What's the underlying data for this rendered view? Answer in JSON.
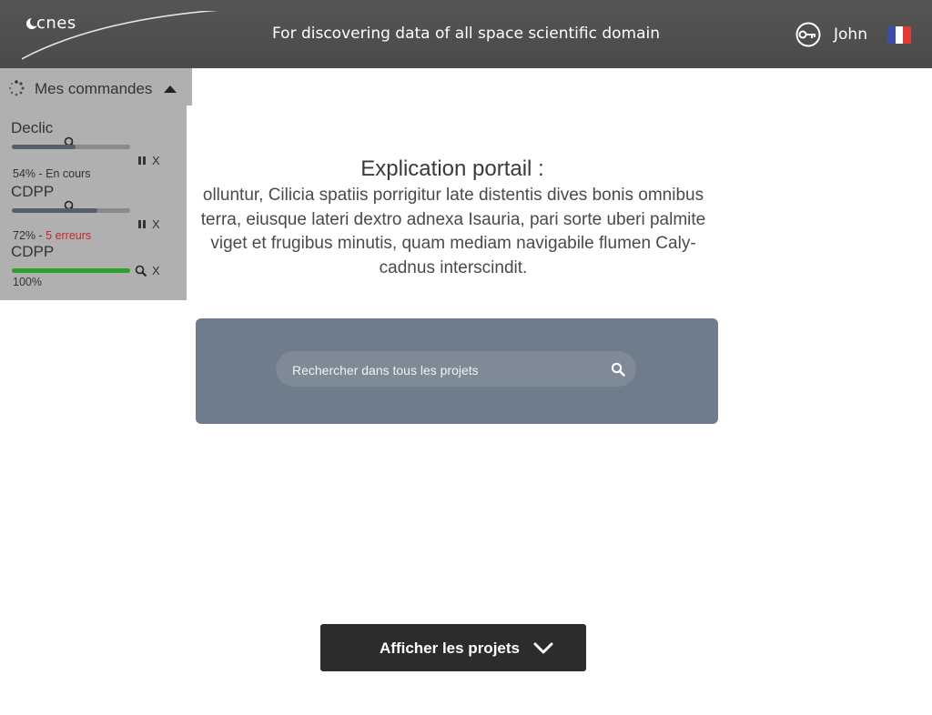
{
  "header": {
    "logo_text": "cnes",
    "tagline": "For discovering data of all space scientific domain",
    "username": "John",
    "flag_colors": [
      "#3b4fa8",
      "#ffffff",
      "#e23a35"
    ]
  },
  "orders": {
    "title": "Mes commandes",
    "items": [
      {
        "name": "Declic",
        "progress": 0.54,
        "status_prefix": "54% - ",
        "status": "En cours",
        "status_color": "#333333",
        "show_pause": true
      },
      {
        "name": "CDPP",
        "progress": 0.72,
        "status_prefix": "72% - ",
        "status": "5 erreurs",
        "status_color": "#c0282d",
        "show_pause": true
      },
      {
        "name": "CDPP",
        "progress": 1.0,
        "status_prefix": "100%",
        "status": "",
        "status_color": "#333333",
        "show_pause": false
      }
    ],
    "close_label": "X"
  },
  "main": {
    "title": "Explication portail :",
    "description_lines": [
      "olluntur, Cilicia spatiis porrigitur late distentis dives bonis omnibus",
      "terra, eiusque lateri dextro adnexa Isauria, pari sorte uberi palmite",
      "viget et frugibus minutis, quam mediam navigabile flumen Caly-",
      "cadnus interscindit."
    ]
  },
  "search": {
    "placeholder": "Rechercher dans tous les projets"
  },
  "projects_button": {
    "label": "Afficher les projets"
  }
}
